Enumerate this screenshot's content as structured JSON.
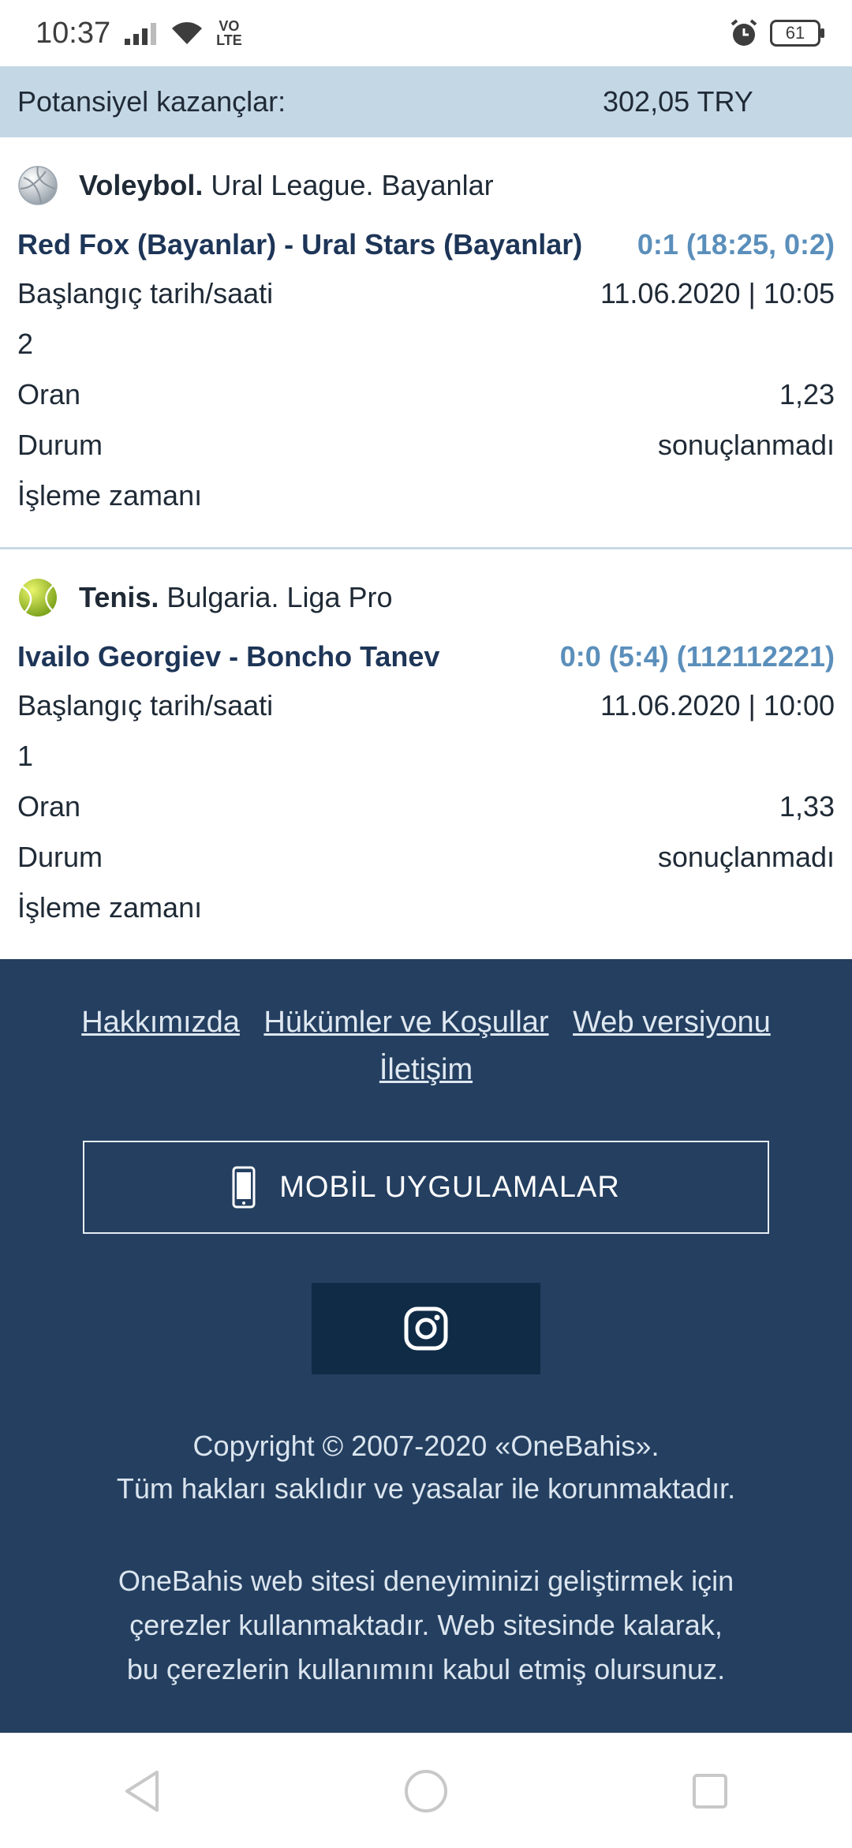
{
  "status_bar": {
    "time": "10:37",
    "network_badge_top": "VO",
    "network_badge_bottom": "LTE",
    "battery": "61"
  },
  "potential": {
    "label": "Potansiyel kazançlar:",
    "value": "302,05 TRY"
  },
  "bets": [
    {
      "sport": "Voleybol.",
      "league": "Ural League. Bayanlar",
      "match": "Red Fox (Bayanlar) - Ural Stars (Bayanlar)",
      "score": "0:1 (18:25, 0:2)",
      "start_label": "Başlangıç tarih/saati",
      "start_value": "11.06.2020 | 10:05",
      "pick": "2",
      "odds_label": "Oran",
      "odds_value": "1,23",
      "status_label": "Durum",
      "status_value": "sonuçlanmadı",
      "processing_label": "İşleme zamanı"
    },
    {
      "sport": "Tenis.",
      "league": "Bulgaria. Liga Pro",
      "match": "Ivailo Georgiev - Boncho Tanev",
      "score": "0:0 (5:4) (112112221)",
      "start_label": "Başlangıç tarih/saati",
      "start_value": "11.06.2020 | 10:00",
      "pick": "1",
      "odds_label": "Oran",
      "odds_value": "1,33",
      "status_label": "Durum",
      "status_value": "sonuçlanmadı",
      "processing_label": "İşleme zamanı"
    }
  ],
  "footer": {
    "links": [
      "Hakkımızda",
      "Hükümler ve Koşullar",
      "Web versiyonu",
      "İletişim"
    ],
    "mobile_apps_label": "MOBİL UYGULAMALAR",
    "copyright_line1": "Copyright © 2007-2020 «OneBahis».",
    "copyright_line2": "Tüm hakları saklıdır ve yasalar ile korunmaktadır.",
    "cookies_line1": "OneBahis web sitesi deneyiminizi geliştirmek için",
    "cookies_line2": "çerezler kullanmaktadır. Web sitesinde kalarak,",
    "cookies_line3": "bu çerezlerin kullanımını kabul etmiş olursunuz."
  },
  "colors": {
    "accent_score": "#5b8fbb",
    "footer_bg": "#243f60",
    "band_bg": "#c4d7e4"
  },
  "icons": {
    "volleyball": "volleyball-icon",
    "tennis": "tennis-ball-icon",
    "phone": "mobile-phone-icon",
    "instagram": "instagram-icon"
  }
}
